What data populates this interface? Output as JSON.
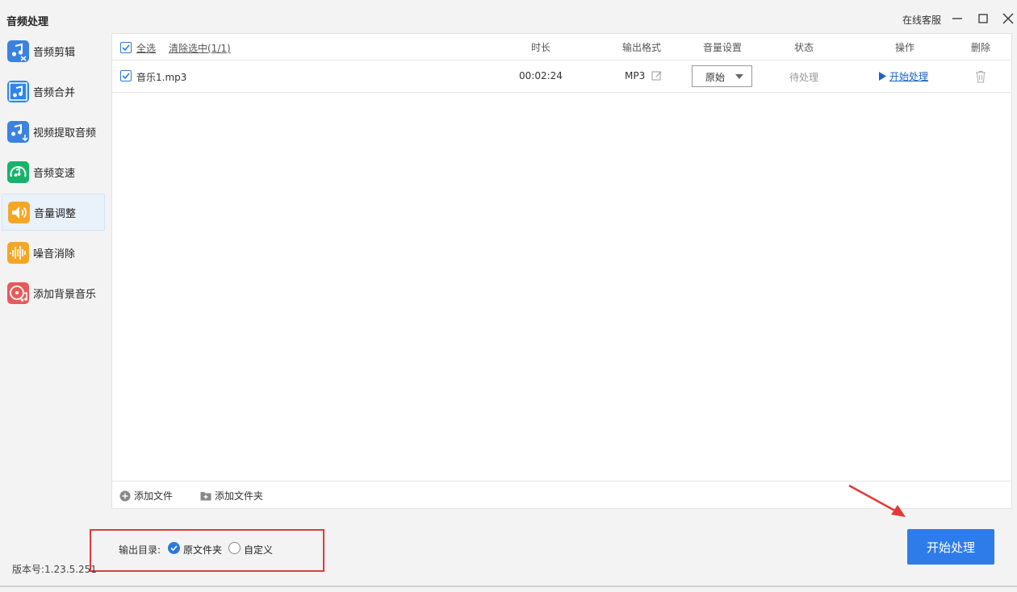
{
  "app": {
    "title": "音频处理",
    "online_service": "在线客服"
  },
  "sidebar": {
    "items": [
      {
        "label": "音频剪辑",
        "icon": "music-scissors-icon",
        "color": "#3b82e0",
        "active": false
      },
      {
        "label": "音频合并",
        "icon": "music-merge-icon",
        "color": "#2f86e6",
        "active": false
      },
      {
        "label": "视频提取音频",
        "icon": "music-download-icon",
        "color": "#3b82e0",
        "active": false
      },
      {
        "label": "音频变速",
        "icon": "speed-gauge-icon",
        "color": "#17b36b",
        "active": false
      },
      {
        "label": "音量调整",
        "icon": "speaker-icon",
        "color": "#f5a623",
        "active": true
      },
      {
        "label": "噪音消除",
        "icon": "waveform-icon",
        "color": "#f5a623",
        "active": false
      },
      {
        "label": "添加背景音乐",
        "icon": "disc-music-icon",
        "color": "#e85a5a",
        "active": false
      }
    ]
  },
  "table": {
    "select_all": "全选",
    "clear_selection": "清除选中(1/1)",
    "headers": {
      "duration": "时长",
      "output_format": "输出格式",
      "volume": "音量设置",
      "status": "状态",
      "action": "操作",
      "delete": "删除"
    },
    "rows": [
      {
        "name": "音乐1.mp3",
        "duration": "00:02:24",
        "format": "MP3",
        "volume": "原始",
        "status": "待处理",
        "action": "开始处理"
      }
    ]
  },
  "footer": {
    "add_file": "添加文件",
    "add_folder": "添加文件夹"
  },
  "output": {
    "label": "输出目录:",
    "option_original": "原文件夹",
    "option_custom": "自定义",
    "selected": "原文件夹"
  },
  "version": "版本号:1.23.5.251",
  "start_button": "开始处理",
  "colors": {
    "accent": "#2e7ce9",
    "highlight_box": "#e23a3a",
    "arrow": "#e23a3a"
  }
}
